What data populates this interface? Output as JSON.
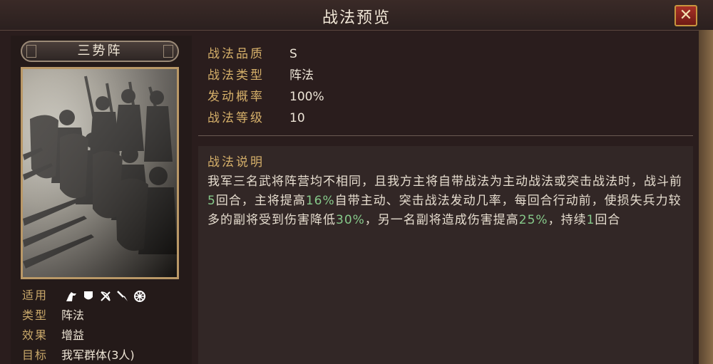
{
  "window": {
    "title": "战法预览",
    "close_label": "✕"
  },
  "skill": {
    "name": "三势阵",
    "meta": {
      "applicable_label": "适用",
      "applicable_units": [
        "cavalry-icon",
        "shield-icon",
        "archer-icon",
        "spear-icon",
        "siege-icon"
      ],
      "type_label": "类型",
      "type_value": "阵法",
      "effect_label": "效果",
      "effect_value": "增益",
      "target_label": "目标",
      "target_value": "我军群体(3人)"
    },
    "info": [
      {
        "key": "战法品质",
        "value": "S"
      },
      {
        "key": "战法类型",
        "value": "阵法"
      },
      {
        "key": "发动概率",
        "value": "100%"
      },
      {
        "key": "战法等级",
        "value": "10"
      }
    ],
    "description": {
      "title": "战法说明",
      "p1": "我军三名武将阵营均不相同，且我方主将自带战法为主动战法或突击战法时，战斗前",
      "n1": "5",
      "p2": "回合，主将提高",
      "n2": "16%",
      "p3": "自带主动、突击战法发动几率，每回合行动前，使损失兵力较多的副将受到伤害降低",
      "n3": "30%",
      "p4": "，另一名副将造成伤害提高",
      "n4": "25%",
      "p5": "，持续",
      "n5": "1",
      "p6": "回合"
    }
  },
  "colors": {
    "highlight": "#86c98a",
    "gold_label": "#d6b06a",
    "close_red": "#a83126"
  }
}
